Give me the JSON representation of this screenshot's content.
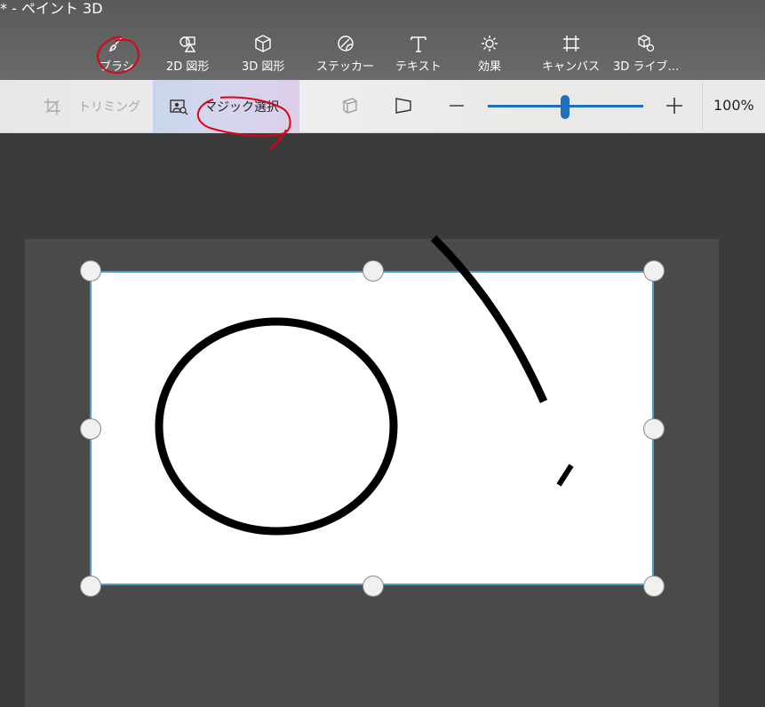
{
  "window": {
    "title": "* - ペイント 3D"
  },
  "toolbar": {
    "tools": [
      {
        "label": "ブラシ",
        "icon": "brush-icon"
      },
      {
        "label": "2D 図形",
        "icon": "2d-shapes-icon"
      },
      {
        "label": "3D 図形",
        "icon": "3d-shapes-icon"
      },
      {
        "label": "ステッカー",
        "icon": "sticker-icon"
      },
      {
        "label": "テキスト",
        "icon": "text-icon"
      },
      {
        "label": "効果",
        "icon": "effects-icon"
      },
      {
        "label": "キャンバス",
        "icon": "canvas-icon"
      },
      {
        "label": "3D ライブ…",
        "icon": "3d-library-icon"
      }
    ]
  },
  "subtoolbar": {
    "trim_label": "トリミング",
    "magic_select_label": "マジック選択",
    "zoom": {
      "value": "100%",
      "level": 0.5
    }
  },
  "colors": {
    "accent": "#1f6fbf",
    "selection_border": "#4a9ec8",
    "annotation": "#e0001a"
  }
}
